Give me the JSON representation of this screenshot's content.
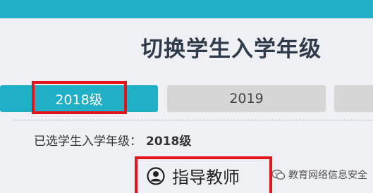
{
  "page_title": "切换学生入学年级",
  "year_tabs": [
    {
      "label": "2018级",
      "active": true
    },
    {
      "label": "2019",
      "active": false
    },
    {
      "label": "",
      "active": false
    }
  ],
  "selected": {
    "label": "已选学生入学年级：",
    "value": "2018级"
  },
  "teacher": {
    "label": "指导教师",
    "icon": "user-circle-icon"
  },
  "watermark": {
    "text": "教育网络信息安全",
    "icon": "wechat-icon"
  },
  "colors": {
    "accent": "#1fb0c8",
    "highlight": "#e3141b",
    "tab_inactive": "#d6d6d6",
    "panel_bg": "#eef0f3"
  }
}
